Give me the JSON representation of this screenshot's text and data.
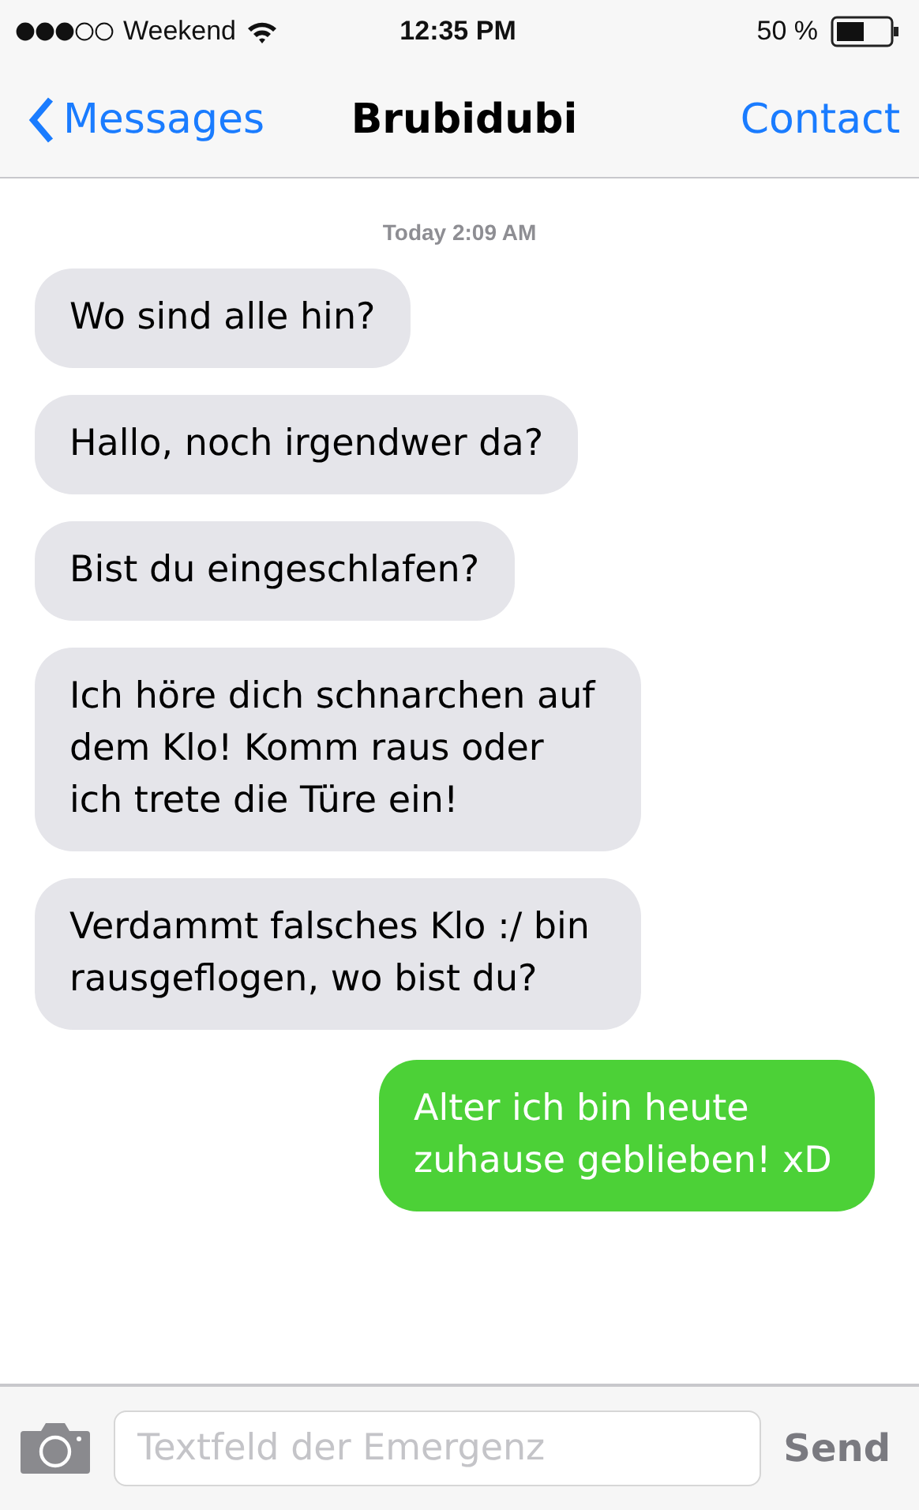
{
  "status_bar": {
    "carrier": "Weekend",
    "time": "12:35 PM",
    "battery": "50 %"
  },
  "nav_bar": {
    "back": "Messages",
    "title": "Brubidubi",
    "action": "Contact"
  },
  "timestamp": "Today 2:09 AM",
  "messages": [
    {
      "kind": "incoming",
      "text": "Wo sind alle hin?"
    },
    {
      "kind": "incoming",
      "text": "Hallo, noch irgendwer da?"
    },
    {
      "kind": "incoming",
      "text": "Bist du eingeschlafen?"
    },
    {
      "kind": "incoming",
      "text": "Ich höre dich schnarchen auf dem Klo! Komm raus oder ich trete die Türe ein!"
    },
    {
      "kind": "incoming",
      "text": "Verdammt falsches Klo :/ bin rausgeflogen, wo bist du?"
    },
    {
      "kind": "outgoing",
      "text": "Alter ich bin heute zuhause geblieben! xD"
    }
  ],
  "composer": {
    "placeholder": "Textfeld der Emergenz",
    "send": "Send"
  }
}
